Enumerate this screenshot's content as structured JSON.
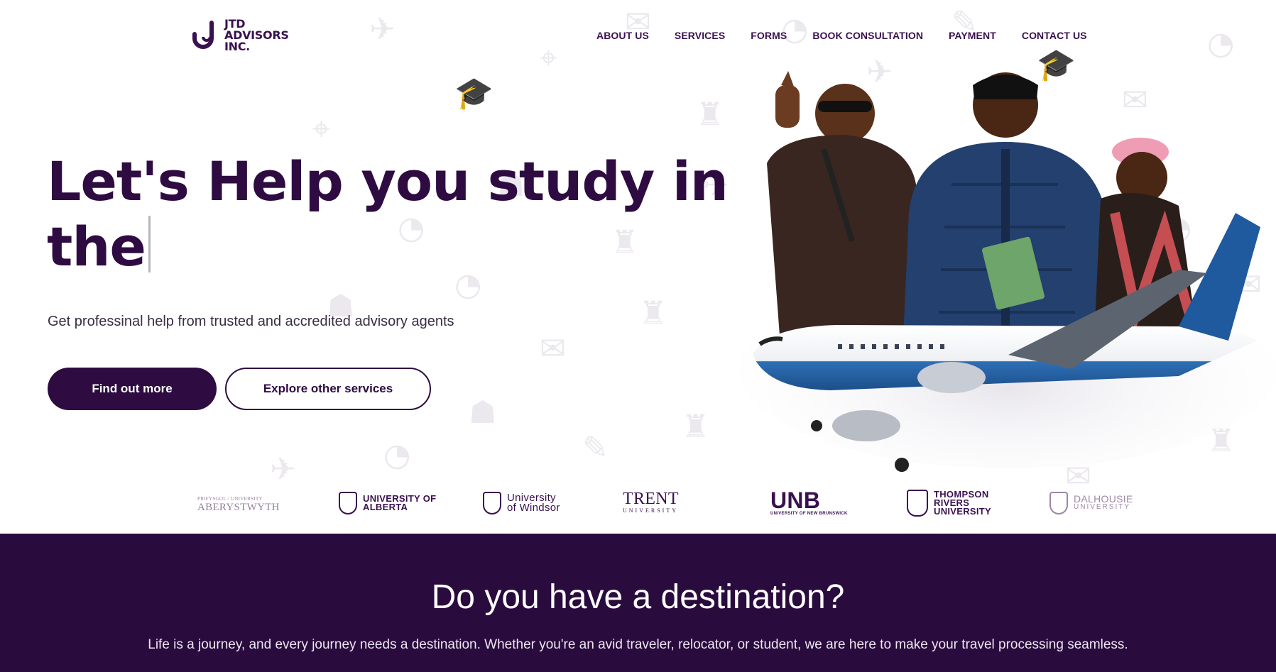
{
  "brand": {
    "logo_line1": "JTD",
    "logo_line2": "ADVISORS",
    "logo_line3": "INC.",
    "primary_color": "#2e0c42",
    "footer_band_color": "#2a0b3d"
  },
  "nav": {
    "items": [
      "ABOUT US",
      "SERVICES",
      "FORMS",
      "BOOK CONSULTATION",
      "PAYMENT",
      "CONTACT US"
    ]
  },
  "hero": {
    "headline_line1": "Let's Help you study in",
    "headline_line2": "the",
    "subheading": "Get professinal help from trusted and accredited advisory agents",
    "primary_button": "Find out more",
    "secondary_button": "Explore other services"
  },
  "universities": [
    {
      "name": "ABERYSTWYTH",
      "sub": "PRIFYSGOL / UNIVERSITY"
    },
    {
      "name": "UNIVERSITY OF ALBERTA",
      "sub": ""
    },
    {
      "name": "University of Windsor",
      "sub": ""
    },
    {
      "name": "TRENT",
      "sub": "UNIVERSITY"
    },
    {
      "name": "UNB",
      "sub": "UNIVERSITY OF NEW BRUNSWICK"
    },
    {
      "name": "THOMPSON RIVERS UNIVERSITY",
      "sub": ""
    },
    {
      "name": "DALHOUSIE",
      "sub": "UNIVERSITY"
    }
  ],
  "destination": {
    "title": "Do you have a destination?",
    "body": "Life is a journey, and every journey needs a destination. Whether you're an avid traveler, relocator, or student, we are here to make your travel processing seamless."
  }
}
